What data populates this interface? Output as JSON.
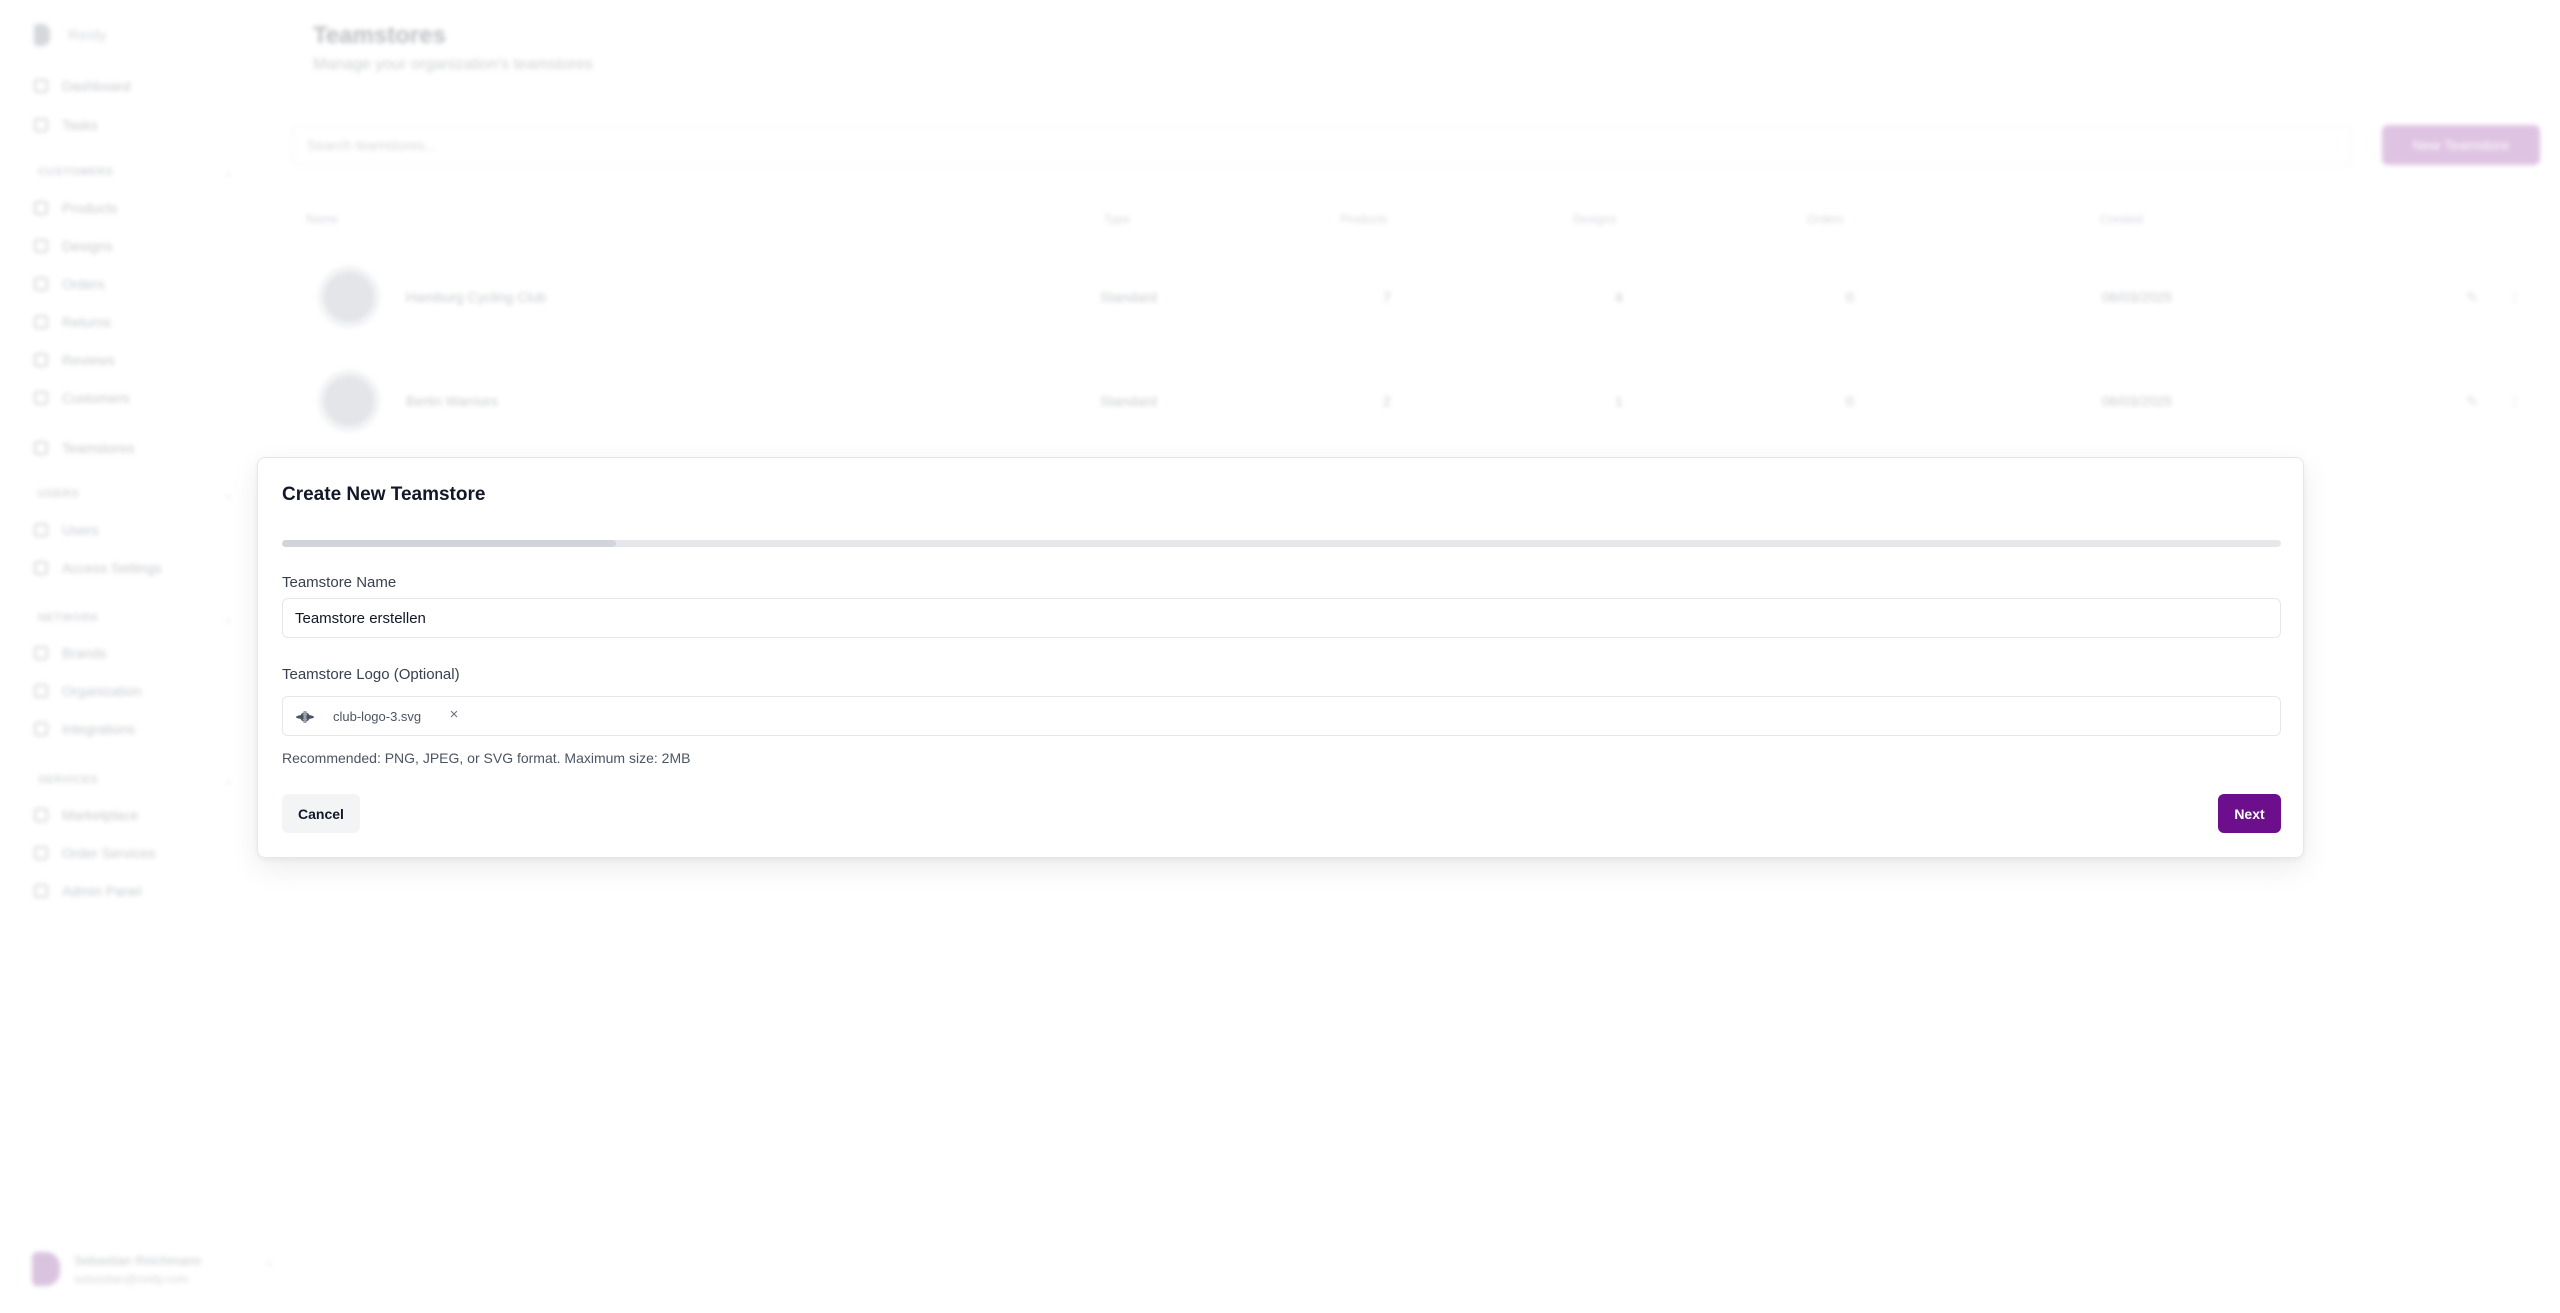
{
  "background": {
    "sidebar": {
      "brand": "Reidy",
      "items_top": [
        "Dashboard",
        "Tasks"
      ],
      "sections": [
        {
          "label": "CUSTOMERS",
          "items": [
            "Products",
            "Designs",
            "Orders",
            "Returns",
            "Reviews",
            "Customers"
          ]
        },
        {
          "label": "",
          "items": [
            "Teamstores"
          ]
        },
        {
          "label": "USERS",
          "items": [
            "Users",
            "Access Settings"
          ]
        },
        {
          "label": "NETWORK",
          "items": [
            "Brands",
            "Organization",
            "Integrations"
          ]
        },
        {
          "label": "SERVICES",
          "items": [
            "Marketplace",
            "Order Services",
            "Admin Panel"
          ]
        }
      ],
      "user": {
        "name": "Sebastian Reichmann",
        "email": "sebastian@reidy.com"
      }
    },
    "page": {
      "title": "Teamstores",
      "subtitle": "Manage your organization's teamstores",
      "search_placeholder": "Search teamstores...",
      "new_button": "New Teamstore",
      "columns": [
        "Name",
        "Type",
        "Products",
        "Designs",
        "Orders",
        "Created"
      ],
      "rows": [
        {
          "name": "Hamburg Cycling Club",
          "type": "Standard",
          "products": "7",
          "designs": "4",
          "orders": "0",
          "created": "06/03/2025"
        },
        {
          "name": "Berlin Warriors",
          "type": "Standard",
          "products": "2",
          "designs": "1",
          "orders": "0",
          "created": "06/03/2025"
        }
      ]
    }
  },
  "modal": {
    "title": "Create New Teamstore",
    "progress": 0.167,
    "name_label": "Teamstore Name",
    "name_value": "Teamstore erstellen",
    "logo_label": "Teamstore Logo (Optional)",
    "file_name": "club-logo-3.svg",
    "remove_glyph": "×",
    "hint": "Recommended: PNG, JPEG, or SVG format. Maximum size: 2MB",
    "cancel_label": "Cancel",
    "next_label": "Next",
    "accent_color": "#6d0f8d"
  }
}
